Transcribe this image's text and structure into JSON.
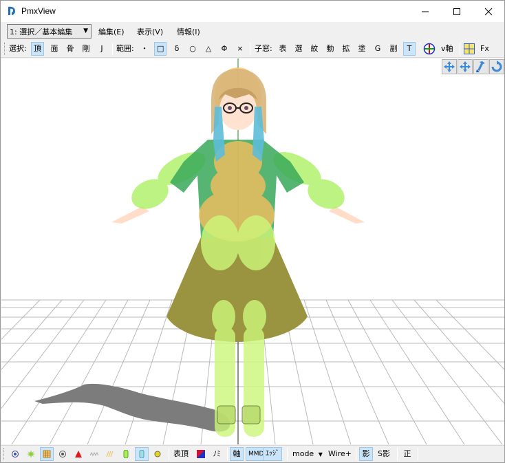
{
  "window": {
    "title": "PmxView"
  },
  "menubar": {
    "mode_select_value": "1: 選択／基本編集",
    "items": [
      "編集(E)",
      "表示(V)",
      "情報(I)"
    ]
  },
  "toolbar": {
    "select_label": "選択:",
    "select_items": [
      "頂",
      "面",
      "骨",
      "剛",
      "J"
    ],
    "range_label": "範囲:",
    "range_items": [
      "・",
      "□",
      "δ",
      "○",
      "△",
      "Φ",
      "×"
    ],
    "child_label": "子窓:",
    "child_items": [
      "表",
      "選",
      "紋",
      "動",
      "拡",
      "塗",
      "G",
      "副",
      "T"
    ],
    "vaxis_label": "v軸",
    "fx_label": "Fx"
  },
  "statusbar": {
    "hyou_label": "表頂",
    "no_label": "ﾉﾐ",
    "axis_label": "軸",
    "mmd_label": "MMD",
    "edge_label": "ｴｯｼﾞ",
    "mode_label": "mode",
    "wire_label": "Wire+",
    "shadow_label": "影",
    "sshadow_label": "S影",
    "sei_label": "正"
  },
  "colors": {
    "accent_blue": "#0078d7",
    "active_bg": "#cce4f7",
    "grid_line": "#b8b8b8",
    "body_green": "#a6f05a",
    "body_orange": "#ffbe5c",
    "skirt": "#8f8a3c"
  }
}
